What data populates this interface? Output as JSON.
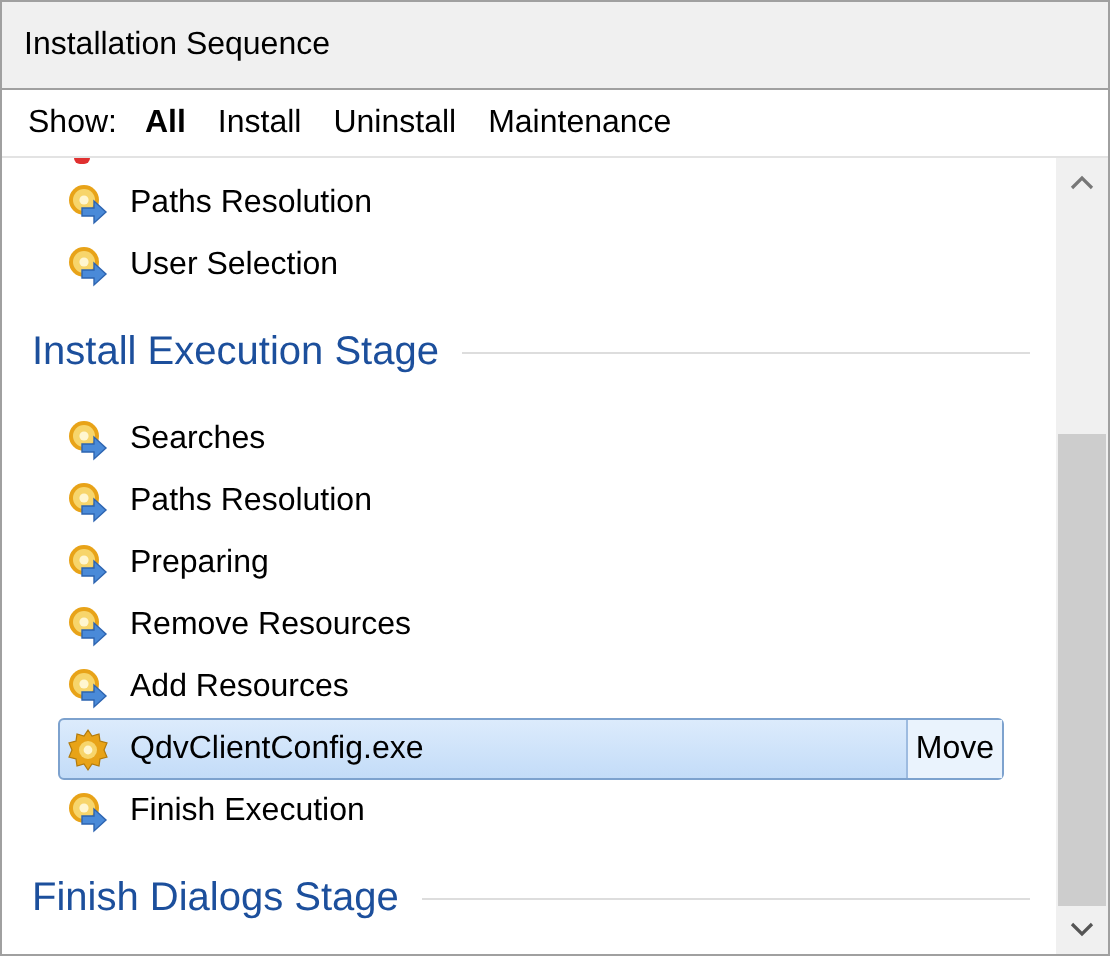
{
  "window": {
    "title": "Installation Sequence"
  },
  "filter": {
    "label": "Show:",
    "options": [
      {
        "label": "All",
        "selected": true
      },
      {
        "label": "Install",
        "selected": false
      },
      {
        "label": "Uninstall",
        "selected": false
      },
      {
        "label": "Maintenance",
        "selected": false
      }
    ]
  },
  "stages": [
    {
      "items": [
        {
          "label": "Paths Resolution",
          "kind": "action",
          "selected": false
        },
        {
          "label": "User Selection",
          "kind": "action",
          "selected": false
        }
      ]
    },
    {
      "title": "Install Execution Stage",
      "items": [
        {
          "label": "Searches",
          "kind": "action",
          "selected": false
        },
        {
          "label": "Paths Resolution",
          "kind": "action",
          "selected": false
        },
        {
          "label": "Preparing",
          "kind": "action",
          "selected": false
        },
        {
          "label": "Remove Resources",
          "kind": "action",
          "selected": false
        },
        {
          "label": "Add Resources",
          "kind": "action",
          "selected": false
        },
        {
          "label": "QdvClientConfig.exe",
          "kind": "exe",
          "selected": true,
          "action": "Move"
        },
        {
          "label": "Finish Execution",
          "kind": "action",
          "selected": false
        }
      ]
    },
    {
      "title": "Finish Dialogs Stage"
    }
  ]
}
